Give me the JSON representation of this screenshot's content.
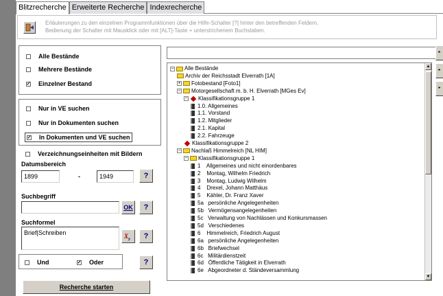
{
  "tabs": [
    "Blitzrecherche",
    "Erweiterte Recherche",
    "Indexrecherche"
  ],
  "info": {
    "line1": "Erläuterungen zu den einzelnen Programmfunktionen über die Hilfe-Schalter [?] hinter den betreffenden Feldern.",
    "line2": "Bedienung der Schalter mit Mausklick oder mit [ALT]-Taste + unterstrichenem Buchstaben."
  },
  "bestand": [
    {
      "label": "Alle Bestände",
      "checked": false
    },
    {
      "label": "Mehrere Bestände",
      "checked": false
    },
    {
      "label": "Einzelner Bestand",
      "checked": true
    }
  ],
  "suchbereich": [
    {
      "label": "Nur in VE suchen",
      "checked": false
    },
    {
      "label": "Nur in Dokumenten suchen",
      "checked": false
    },
    {
      "label": "In Dokumenten und VE suchen",
      "checked": true
    }
  ],
  "bilder": {
    "label": "Verzeichnungseinheiten mit Bildern",
    "checked": false
  },
  "datum": {
    "title": "Datumsbereich",
    "from": "1899",
    "sep": "-",
    "to": "1949"
  },
  "suchbegriff": {
    "title": "Suchbegriff",
    "value": "",
    "ok": "OK"
  },
  "suchformel": {
    "title": "Suchformel",
    "value": "Brief|Schreiben"
  },
  "logic": {
    "und": "Und",
    "und_checked": false,
    "oder": "Oder",
    "oder_checked": true
  },
  "help": "?",
  "start_button": "Recherche starten",
  "tree": [
    {
      "indent": 0,
      "icon": "folder-open",
      "expander": "−",
      "text": "Alle Bestände"
    },
    {
      "indent": 1,
      "icon": "folder",
      "expander": "",
      "text": "Archiv der Reichsstadt Elverrath [1A]"
    },
    {
      "indent": 1,
      "icon": "folder",
      "expander": "+",
      "text": "Fotobestand [Foto1]"
    },
    {
      "indent": 1,
      "icon": "folder-open",
      "expander": "−",
      "text": "Motorgesellschaft m. b. H. Elverrath [MGes Ev]"
    },
    {
      "indent": 2,
      "icon": "diamond",
      "expander": "−",
      "text": "Klassifikationsgruppe 1"
    },
    {
      "indent": 3,
      "icon": "doc",
      "expander": "",
      "text": "1.0. Allgemeines"
    },
    {
      "indent": 3,
      "icon": "doc",
      "expander": "",
      "text": "1.1. Vorstand"
    },
    {
      "indent": 3,
      "icon": "doc",
      "expander": "",
      "text": "1.2. Mitglieder"
    },
    {
      "indent": 3,
      "icon": "doc",
      "expander": "",
      "text": "2.1. Kapital"
    },
    {
      "indent": 3,
      "icon": "doc",
      "expander": "",
      "text": "2.2. Fahrzeuge"
    },
    {
      "indent": 2,
      "icon": "diamond",
      "expander": "",
      "text": "Klassifikationsgruppe 2"
    },
    {
      "indent": 1,
      "icon": "folder-open",
      "expander": "−",
      "text": "Nachlaß Himmelreich [NL HIM]"
    },
    {
      "indent": 2,
      "icon": "folder-open",
      "expander": "−",
      "text": "Klassifikationsgruppe 1"
    },
    {
      "indent": 3,
      "icon": "doc",
      "expander": "",
      "text": "1    Allgemeines und nicht einordenbares"
    },
    {
      "indent": 3,
      "icon": "doc",
      "expander": "",
      "text": "2    Montag, Wilhelm Friedrich"
    },
    {
      "indent": 3,
      "icon": "doc",
      "expander": "",
      "text": "3    Montag, Ludwig Wilhelm"
    },
    {
      "indent": 3,
      "icon": "doc",
      "expander": "",
      "text": "4    Drexel, Johann Matthäus"
    },
    {
      "indent": 3,
      "icon": "doc",
      "expander": "",
      "text": "5    Kähler, Dr. Franz Xaver"
    },
    {
      "indent": 3,
      "icon": "doc",
      "expander": "",
      "text": "5a   persönliche Angelegenheiten"
    },
    {
      "indent": 3,
      "icon": "doc",
      "expander": "",
      "text": "5b   Vermögensangelegenheiten"
    },
    {
      "indent": 3,
      "icon": "doc",
      "expander": "",
      "text": "5c   Verwaltung von Nachlässen und Konkursmassen"
    },
    {
      "indent": 3,
      "icon": "doc",
      "expander": "",
      "text": "5d   Verschiedenes"
    },
    {
      "indent": 3,
      "icon": "doc",
      "expander": "",
      "text": "6    Himmelreich, Friedrich August"
    },
    {
      "indent": 3,
      "icon": "doc",
      "expander": "",
      "text": "6a   persönliche Angelegenheiten"
    },
    {
      "indent": 3,
      "icon": "doc",
      "expander": "",
      "text": "6b   Briefwechsel"
    },
    {
      "indent": 3,
      "icon": "doc",
      "expander": "",
      "text": "6c   Militärdienstzeit"
    },
    {
      "indent": 3,
      "icon": "doc",
      "expander": "",
      "text": "6d   Öffentliche Tätigkeit in Elverrath"
    },
    {
      "indent": 3,
      "icon": "doc",
      "expander": "",
      "text": "6e   Abgeordneter d. Ständeversammlung"
    }
  ]
}
